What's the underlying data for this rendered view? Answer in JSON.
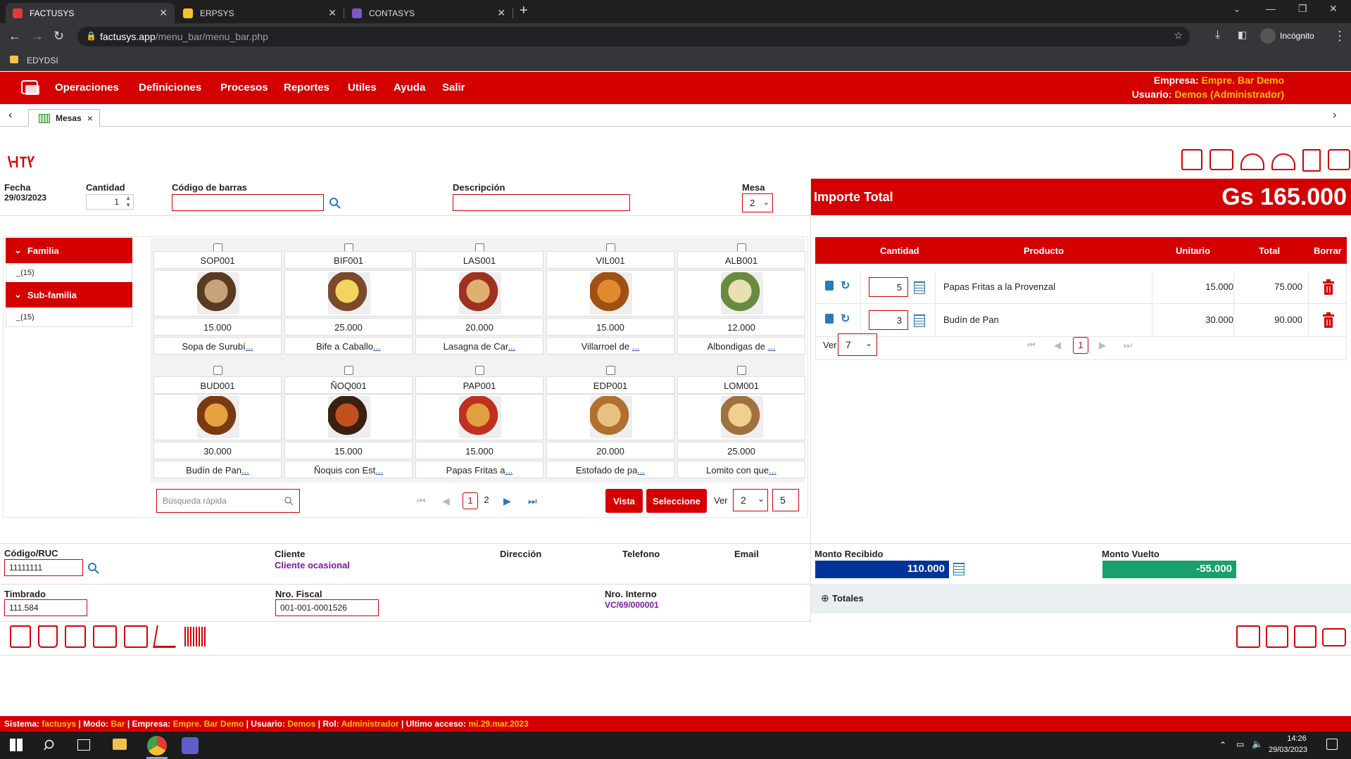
{
  "browser": {
    "tabs": [
      {
        "label": "FACTUSYS",
        "color": "#e53935"
      },
      {
        "label": "ERPSYS",
        "color": "#fbc02d"
      },
      {
        "label": "CONTASYS",
        "color": "#7e57c2"
      }
    ],
    "new_tab": "+",
    "url_host": "factusys.app",
    "url_path": "/menu_bar/menu_bar.php",
    "profile": "Incógnito",
    "bookmark": "EDYDSI"
  },
  "menu": [
    "Operaciones",
    "Definiciones",
    "Procesos",
    "Reportes",
    "Utiles",
    "Ayuda",
    "Salir"
  ],
  "header": {
    "empresa_label": "Empresa:",
    "empresa_value": "Empre. Bar Demo",
    "usuario_label": "Usuario:",
    "usuario_value": "Demos (Administrador)"
  },
  "tab": {
    "label": "Mesas",
    "close": "×"
  },
  "form": {
    "fecha_label": "Fecha",
    "fecha_value": "29/03/2023",
    "cantidad_label": "Cantidad",
    "cantidad_value": "1",
    "codigo_label": "Código de barras",
    "descripcion_label": "Descripción",
    "mesa_label": "Mesa",
    "mesa_value": "2"
  },
  "families": {
    "familia_label": "Familia",
    "familia_item": "_(15)",
    "subfamilia_label": "Sub-familia",
    "subfamilia_item": "_(15)"
  },
  "products": [
    {
      "code": "SOP001",
      "price": "15.000",
      "name": "Sopa de Surubí",
      "c1": "#c8a27a",
      "c2": "#5a3a20"
    },
    {
      "code": "BIF001",
      "price": "25.000",
      "name": "Bife a Caballo",
      "c1": "#f4d35e",
      "c2": "#7a4a2a"
    },
    {
      "code": "LAS001",
      "price": "20.000",
      "name": "Lasagna de Car",
      "c1": "#e0b070",
      "c2": "#a03020"
    },
    {
      "code": "VIL001",
      "price": "15.000",
      "name": "Villarroel de ",
      "c1": "#e08a30",
      "c2": "#a05010"
    },
    {
      "code": "ALB001",
      "price": "12.000",
      "name": "Albondigas de ",
      "c1": "#e8e0b0",
      "c2": "#6a8a40"
    },
    {
      "code": "BUD001",
      "price": "30.000",
      "name": "Budín de Pan",
      "c1": "#e8a040",
      "c2": "#7a3a10"
    },
    {
      "code": "ÑOQ001",
      "price": "15.000",
      "name": "Ñoquis con Est",
      "c1": "#c05020",
      "c2": "#3a2010"
    },
    {
      "code": "PAP001",
      "price": "15.000",
      "name": "Papas Fritas a",
      "c1": "#e0a040",
      "c2": "#c03020"
    },
    {
      "code": "EDP001",
      "price": "20.000",
      "name": "Estofado de pa",
      "c1": "#e8c080",
      "c2": "#b07030"
    },
    {
      "code": "LOM001",
      "price": "25.000",
      "name": "Lomito con que",
      "c1": "#f0d090",
      "c2": "#a07040"
    }
  ],
  "ellipsis": "...",
  "grid_controls": {
    "search_placeholder": "Búsqueda rápida",
    "pages": [
      "1",
      "2"
    ],
    "vista": "Vista",
    "seleccione": "Seleccione",
    "ver_label": "Ver",
    "ver_value": "2",
    "ver_count": "5"
  },
  "total": {
    "label": "Importe Total",
    "value": "Gs 165.000"
  },
  "order_headers": {
    "cantidad": "Cantidad",
    "producto": "Producto",
    "unitario": "Unitario",
    "total": "Total",
    "borrar": "Borrar"
  },
  "orders": [
    {
      "qty": "5",
      "product": "Papas Fritas a la Provenzal",
      "unit": "15.000",
      "total": "75.000"
    },
    {
      "qty": "3",
      "product": "Budín de Pan",
      "unit": "30.000",
      "total": "90.000"
    }
  ],
  "order_pager": {
    "ver_label": "Ver",
    "ver_value": "7",
    "page": "1"
  },
  "client": {
    "codigo_label": "Código/RUC",
    "codigo_value": "11111111",
    "cliente_label": "Cliente",
    "cliente_value": "Cliente ocasional",
    "direccion_label": "Dirección",
    "telefono_label": "Telefono",
    "email_label": "Email",
    "timbrado_label": "Timbrado",
    "timbrado_value": "111.584",
    "nro_fiscal_label": "Nro. Fiscal",
    "nro_fiscal_value": "001-001-0001526",
    "nro_interno_label": "Nro. Interno",
    "nro_interno_value": "VC/69/000001"
  },
  "payment": {
    "recibido_label": "Monto Recibido",
    "recibido_value": "110.000",
    "vuelto_label": "Monto Vuelto",
    "vuelto_value": "-55.000",
    "totales_label": "Totales"
  },
  "footer": {
    "sistema_label": "Sistema:",
    "sistema": "factusys",
    "modo_label": "| Modo:",
    "modo": "Bar",
    "empresa_label": "| Empresa:",
    "empresa": "Empre. Bar Demo",
    "usuario_label": "| Usuario:",
    "usuario": "Demos",
    "rol_label": "| Rol:",
    "rol": "Administrador",
    "acceso_label": "| Ultimo acceso:",
    "acceso": "mi.29.mar.2023"
  },
  "taskbar": {
    "time": "14:26",
    "date": "29/03/2023"
  },
  "colors": {
    "brand": "#d40000",
    "accent": "#ffc000",
    "blue": "#003399",
    "green": "#1aa06b"
  }
}
